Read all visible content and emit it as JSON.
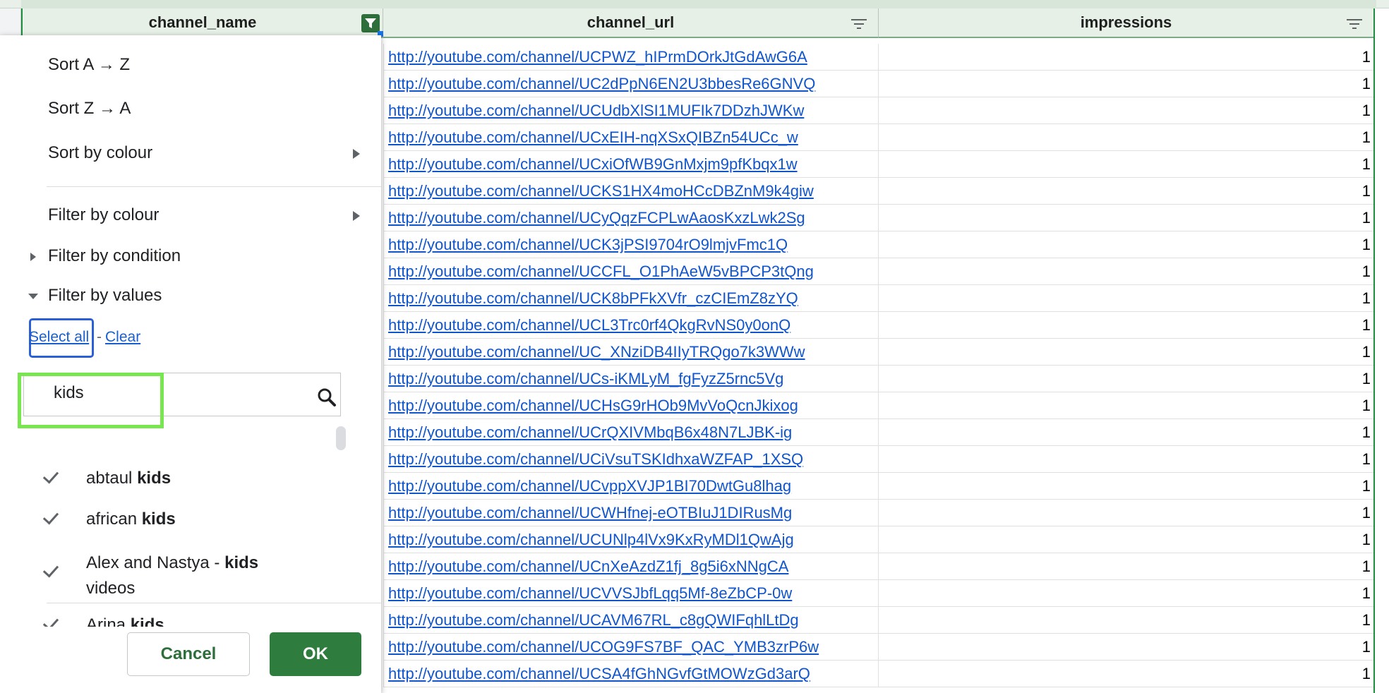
{
  "headers": {
    "col1": "channel_name",
    "col2": "channel_url",
    "col3": "impressions"
  },
  "rows": [
    {
      "url": "http://youtube.com/channel/UCPWZ_hIPrmDOrkJtGdAwG6A",
      "impressions": "1"
    },
    {
      "url": "http://youtube.com/channel/UC2dPpN6EN2U3bbesRe6GNVQ",
      "impressions": "1"
    },
    {
      "url": "http://youtube.com/channel/UCUdbXlSI1MUFIk7DDzhJWKw",
      "impressions": "1"
    },
    {
      "url": "http://youtube.com/channel/UCxEIH-nqXSxQIBZn54UCc_w",
      "impressions": "1"
    },
    {
      "url": "http://youtube.com/channel/UCxiOfWB9GnMxjm9pfKbqx1w",
      "impressions": "1"
    },
    {
      "url": "http://youtube.com/channel/UCKS1HX4moHCcDBZnM9k4giw",
      "impressions": "1"
    },
    {
      "url": "http://youtube.com/channel/UCyQqzFCPLwAaosKxzLwk2Sg",
      "impressions": "1"
    },
    {
      "url": "http://youtube.com/channel/UCK3jPSI9704rO9lmjvFmc1Q",
      "impressions": "1"
    },
    {
      "url": "http://youtube.com/channel/UCCFL_O1PhAeW5vBPCP3tQng",
      "impressions": "1"
    },
    {
      "url": "http://youtube.com/channel/UCK8bPFkXVfr_czCIEmZ8zYQ",
      "impressions": "1"
    },
    {
      "url": "http://youtube.com/channel/UCL3Trc0rf4QkgRvNS0y0onQ",
      "impressions": "1"
    },
    {
      "url": "http://youtube.com/channel/UC_XNziDB4IIyTRQgo7k3WWw",
      "impressions": "1"
    },
    {
      "url": "http://youtube.com/channel/UCs-iKMLyM_fgFyzZ5rnc5Vg",
      "impressions": "1"
    },
    {
      "url": "http://youtube.com/channel/UCHsG9rHOb9MvVoQcnJkixog",
      "impressions": "1"
    },
    {
      "url": "http://youtube.com/channel/UCrQXIVMbqB6x48N7LJBK-ig",
      "impressions": "1"
    },
    {
      "url": "http://youtube.com/channel/UCiVsuTSKIdhxaWZFAP_1XSQ",
      "impressions": "1"
    },
    {
      "url": "http://youtube.com/channel/UCvppXVJP1BI70DwtGu8lhag",
      "impressions": "1"
    },
    {
      "url": "http://youtube.com/channel/UCWHfnej-eOTBIuJ1DIRusMg",
      "impressions": "1"
    },
    {
      "url": "http://youtube.com/channel/UCUNlp4lVx9KxRyMDl1QwAjg",
      "impressions": "1"
    },
    {
      "url": "http://youtube.com/channel/UCnXeAzdZ1fj_8g5i6xNNgCA",
      "impressions": "1"
    },
    {
      "url": "http://youtube.com/channel/UCVVSJbfLqq5Mf-8eZbCP-0w",
      "impressions": "1"
    },
    {
      "url": "http://youtube.com/channel/UCAVM67RL_c8gQWIFqhlLtDg",
      "impressions": "1"
    },
    {
      "url": "http://youtube.com/channel/UCOG9FS7BF_QAC_YMB3zrP6w",
      "impressions": "1"
    },
    {
      "url": "http://youtube.com/channel/UCSA4fGhNGvfGtMOWzGd3arQ",
      "impressions": "1"
    }
  ],
  "menu": {
    "sort_az": "Sort A → Z",
    "sort_za": "Sort Z → A",
    "sort_by_colour": "Sort by colour",
    "filter_by_colour": "Filter by colour",
    "filter_by_condition": "Filter by condition",
    "filter_by_values": "Filter by values",
    "select_all": "Select all",
    "separator": "-",
    "clear": "Clear",
    "search_value": "kids",
    "values": [
      {
        "prefix": "abtaul ",
        "bold": "kids",
        "suffix": ""
      },
      {
        "prefix": "african ",
        "bold": "kids",
        "suffix": ""
      },
      {
        "prefix": "Alex and Nastya - ",
        "bold": "kids",
        "suffix": "videos"
      },
      {
        "prefix": "Arina ",
        "bold": "kids",
        "suffix": ""
      }
    ],
    "cancel": "Cancel",
    "ok": "OK"
  },
  "colors": {
    "header_bg": "#e6f0e7",
    "link": "#1155cc",
    "ok_button": "#2e7d3e",
    "highlight": "#77e64f",
    "focus_ring": "#2b5fd6"
  }
}
